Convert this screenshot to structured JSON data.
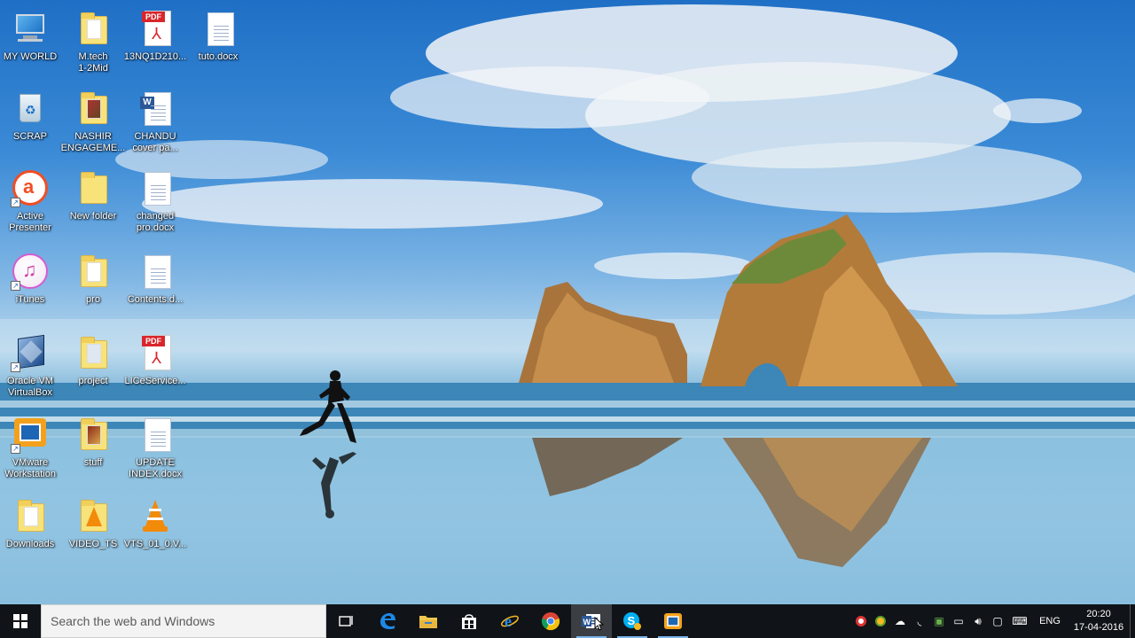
{
  "desktop": {
    "icons": [
      {
        "label": "MY WORLD",
        "type": "computer"
      },
      {
        "label": "M.tech\n1-2Mid",
        "type": "folder"
      },
      {
        "label": "13NQ1D210...",
        "type": "pdf"
      },
      {
        "label": "tuto.docx",
        "type": "doc"
      },
      {
        "label": "SCRAP",
        "type": "recycle"
      },
      {
        "label": "NASHIR\nENGAGEME...",
        "type": "folder"
      },
      {
        "label": "CHANDU\ncover pa...",
        "type": "word"
      },
      {
        "label": "Active\nPresenter",
        "type": "activepresenter"
      },
      {
        "label": "New folder",
        "type": "folder"
      },
      {
        "label": "changed\npro.docx",
        "type": "doc"
      },
      {
        "label": "iTunes",
        "type": "itunes"
      },
      {
        "label": "pro",
        "type": "folder"
      },
      {
        "label": "Contents.d...",
        "type": "doc"
      },
      {
        "label": "Oracle VM\nVirtualBox",
        "type": "virtualbox"
      },
      {
        "label": "project",
        "type": "folder"
      },
      {
        "label": "LICeService...",
        "type": "pdf"
      },
      {
        "label": "VMware\nWorkstation",
        "type": "vmware"
      },
      {
        "label": "stuff",
        "type": "folder"
      },
      {
        "label": "UPDATE\nINDEX.docx",
        "type": "doc"
      },
      {
        "label": "Downloads",
        "type": "folder"
      },
      {
        "label": "VIDEO_TS",
        "type": "vlcfolder"
      },
      {
        "label": "VTS_01_0.V...",
        "type": "vlc"
      }
    ]
  },
  "taskbar": {
    "search_placeholder": "Search the web and Windows",
    "apps": [
      {
        "name": "task-view",
        "icon": "task-view-icon"
      },
      {
        "name": "edge",
        "icon": "edge-icon"
      },
      {
        "name": "file-explorer",
        "icon": "folder-icon"
      },
      {
        "name": "store",
        "icon": "store-icon"
      },
      {
        "name": "internet-explorer",
        "icon": "ie-icon"
      },
      {
        "name": "chrome",
        "icon": "chrome-icon"
      },
      {
        "name": "word",
        "icon": "word-icon"
      },
      {
        "name": "skype",
        "icon": "skype-icon"
      },
      {
        "name": "vmware",
        "icon": "vmware-icon"
      }
    ],
    "tray": {
      "language": "ENG",
      "time": "20:20",
      "date": "17-04-2016"
    }
  },
  "colors": {
    "taskbar_bg": "#101418",
    "accent": "#7eb4ea",
    "word_blue": "#2b5797",
    "pdf_red": "#d9262c"
  }
}
